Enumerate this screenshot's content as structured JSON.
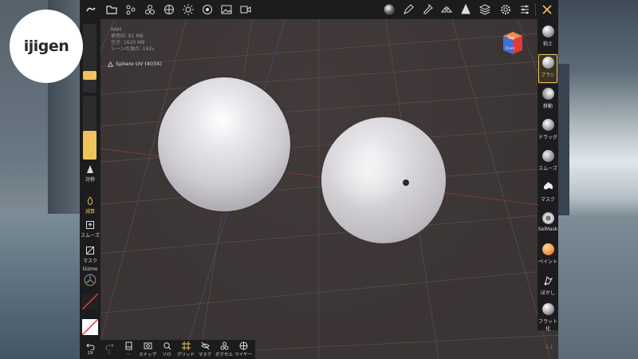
{
  "logo": {
    "text": "ijigen"
  },
  "info": {
    "ram": "RAM",
    "usage": "使用中: 81 MB",
    "total": "空き: 1620 MB",
    "scene": "シーンの頂点: 162v"
  },
  "layer": {
    "label": "Sphere UV (4034)"
  },
  "view_cube": {
    "top": "Top",
    "front": "Front"
  },
  "left_panel": {
    "radius_fill": 0.12,
    "intensity_fill": 0.45,
    "items": [
      {
        "label": "対称",
        "icon": "symmetry-icon",
        "active": false
      },
      {
        "label": "減算",
        "icon": "subtract-icon",
        "active": true
      },
      {
        "label": "スムーズ",
        "icon": "smooth-icon",
        "active": false
      },
      {
        "label": "マスク",
        "icon": "mask-icon",
        "active": false
      },
      {
        "label": "Gizmo",
        "icon": "gizmo-icon",
        "active": false
      }
    ]
  },
  "right_tools": [
    {
      "label": "粘土",
      "icon": "clay-icon",
      "active": false
    },
    {
      "label": "ブラシ",
      "icon": "brush-icon",
      "active": true
    },
    {
      "label": "移動",
      "icon": "move-icon",
      "active": false
    },
    {
      "label": "ドラッグ",
      "icon": "drag-icon",
      "active": false
    },
    {
      "label": "スムーズ",
      "icon": "smooth-icon",
      "active": false
    },
    {
      "label": "マスク",
      "icon": "mask-icon",
      "active": false
    },
    {
      "label": "SelMask",
      "icon": "selmask-icon",
      "active": false
    },
    {
      "label": "ペイント",
      "icon": "paint-icon",
      "active": false
    },
    {
      "label": "ぼかし",
      "icon": "blur-icon",
      "active": false
    },
    {
      "label": "フラット化",
      "icon": "flatten-icon",
      "active": false
    }
  ],
  "bottom_bar": {
    "undo_count": "29",
    "redo_count": "0",
    "items": [
      {
        "label": "...",
        "icon": "object-icon"
      },
      {
        "label": "スナップ",
        "icon": "snap-icon"
      },
      {
        "label": "ソロ",
        "icon": "solo-icon"
      },
      {
        "label": "グリッド",
        "icon": "grid-icon"
      },
      {
        "label": "マスク",
        "icon": "mask-visibility-icon"
      },
      {
        "label": "ボクセル",
        "icon": "voxel-icon"
      },
      {
        "label": "ワイヤー",
        "icon": "wireframe-icon"
      }
    ]
  },
  "top_toolbar": {
    "icons": [
      "menu-icon",
      "files-icon",
      "scene-icon",
      "tools-icon",
      "globe-icon",
      "light-icon",
      "material-icon",
      "image-icon",
      "video-icon",
      "matcap-sphere-icon",
      "pen-icon",
      "dropper-icon",
      "symmetry-icon",
      "cone-icon",
      "layers-icon",
      "settings-icon",
      "sliders-icon",
      "tools-cross-icon"
    ]
  },
  "corner": {
    "text": "1.1"
  },
  "colors": {
    "accent": "#f0c35a",
    "panel": "#1c1c1e",
    "viewport": "#3b3434"
  }
}
